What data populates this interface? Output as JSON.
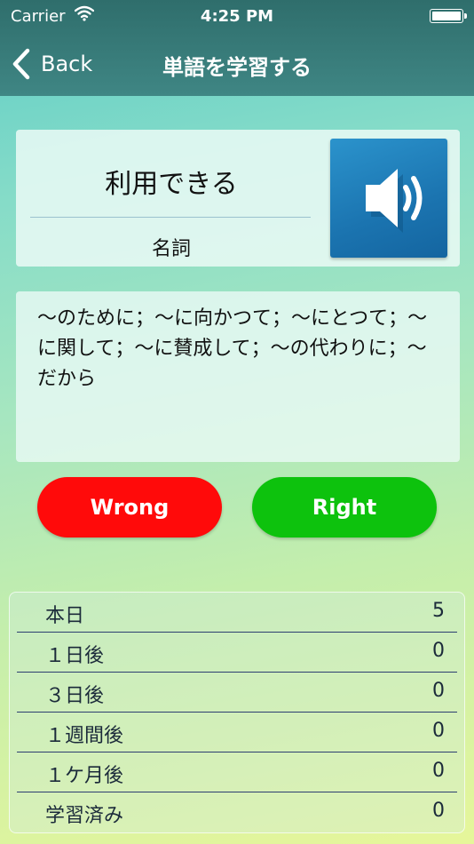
{
  "status_bar": {
    "carrier": "Carrier",
    "time": "4:25 PM"
  },
  "nav": {
    "back_label": "Back",
    "title": "単語を学習する"
  },
  "word_card": {
    "word": "利用できる",
    "part_of_speech": "名詞",
    "speaker_icon": "speaker-volume-icon"
  },
  "definition": {
    "text": "～のために；～に向かつて；～にとつて；～に関して；～に賛成して；～の代わりに；～だから"
  },
  "buttons": {
    "wrong": "Wrong",
    "right": "Right"
  },
  "colors": {
    "wrong": "#ff0a0a",
    "right": "#0dc20d",
    "nav": "#3a7e7c",
    "speaker": "#1b74b0"
  },
  "stats": [
    {
      "label": "本日",
      "count": "5"
    },
    {
      "label": "１日後",
      "count": "0"
    },
    {
      "label": "３日後",
      "count": "0"
    },
    {
      "label": "１週間後",
      "count": "0"
    },
    {
      "label": "１ケ月後",
      "count": "0"
    },
    {
      "label": "学習済み",
      "count": "0"
    }
  ]
}
